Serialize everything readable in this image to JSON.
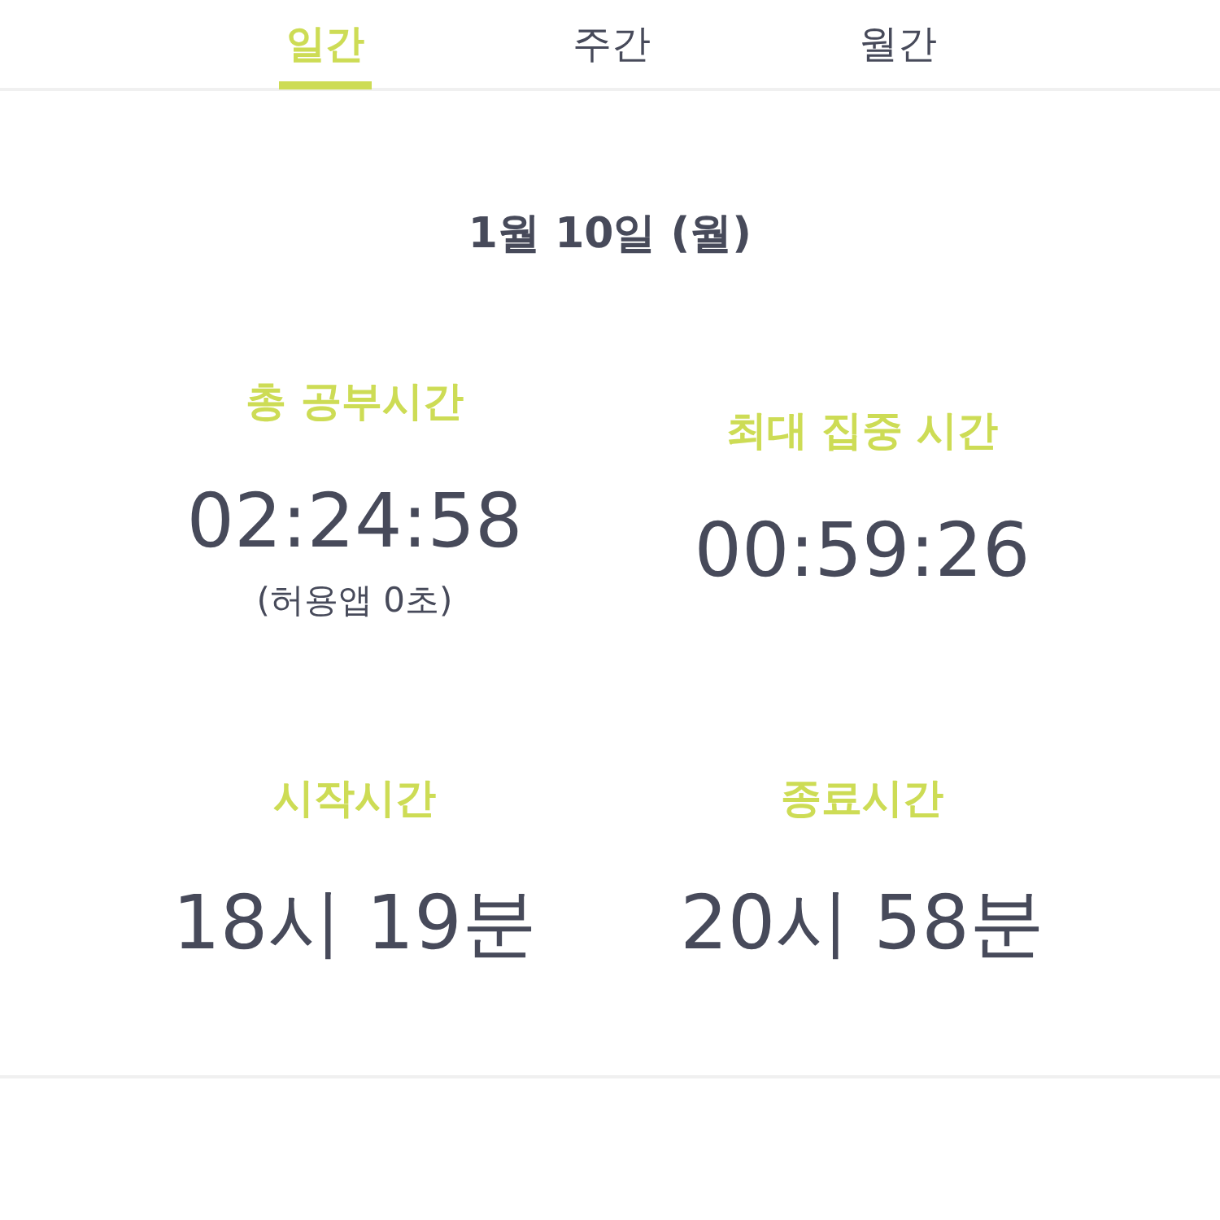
{
  "tabs": [
    {
      "label": "일간",
      "selected": true
    },
    {
      "label": "주간",
      "selected": false
    },
    {
      "label": "월간",
      "selected": false
    }
  ],
  "date": "1월 10일 (월)",
  "stats": [
    {
      "label": "총 공부시간",
      "value": "02:24:58",
      "note": "(허용앱  0초)"
    },
    {
      "label": "최대 집중 시간",
      "value": "00:59:26"
    },
    {
      "label": "시작시간",
      "value": "18시 19분"
    },
    {
      "label": "종료시간",
      "value": "20시 58분"
    }
  ]
}
